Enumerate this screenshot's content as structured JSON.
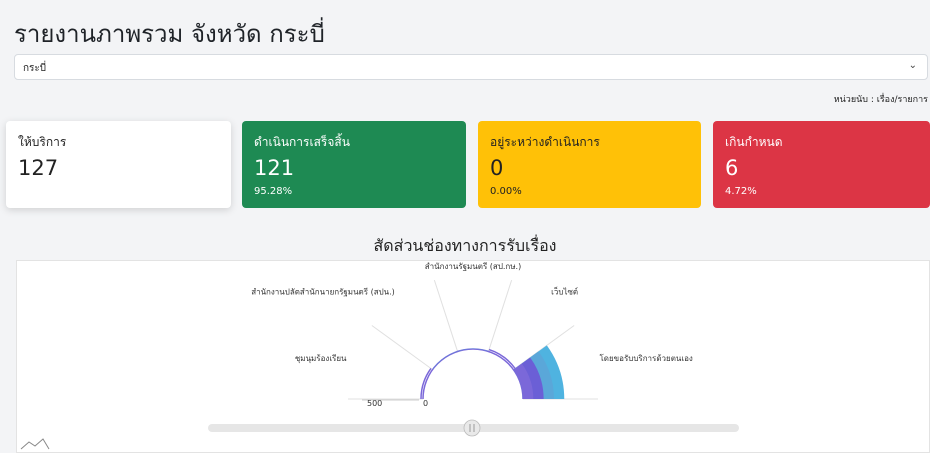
{
  "page": {
    "title": "รายงานภาพรวม จังหวัด กระบี่"
  },
  "province_select": {
    "value": "กระบี่",
    "chevron_icon": "chevron-down-icon"
  },
  "unit_note": "หน่วยนับ : เรื่อง/รายการ",
  "cards": [
    {
      "label": "ให้บริการ",
      "value": "127",
      "percent": "",
      "color": "#ffffff"
    },
    {
      "label": "ดำเนินการเสร็จสิ้น",
      "value": "121",
      "percent": "95.28%",
      "color": "#1e8a53"
    },
    {
      "label": "อยู่ระหว่างดำเนินการ",
      "value": "0",
      "percent": "0.00%",
      "color": "#ffc107"
    },
    {
      "label": "เกินกำหนด",
      "value": "6",
      "percent": "4.72%",
      "color": "#dc3545"
    }
  ],
  "chart_title": "สัดส่วนช่องทางการรับเรื่อง",
  "chart_data": {
    "type": "pie",
    "title": "สัดส่วนช่องทางการรับเรื่อง",
    "categories": [
      "ชุมนุมร้องเรียน",
      "สำนักงานปลัดสำนักนายกรัฐมนตรี (สปน.)",
      "สำนักงานรัฐมนตรี (สป.กษ.)",
      "เว็บไซต์",
      "โดยขอรับบริการด้วยตนเอง"
    ],
    "values": [
      0,
      1,
      1,
      0,
      125
    ],
    "radial_axis_labels": [
      "500",
      "0"
    ],
    "colors": [
      "#7b8fd9",
      "#7b68d9",
      "#6b5fd6",
      "#5aa7d9",
      "#4fb3e0"
    ]
  },
  "icons": {
    "chart_menu": "area-chart-icon",
    "slider_handle": "drag-handle-icon"
  }
}
